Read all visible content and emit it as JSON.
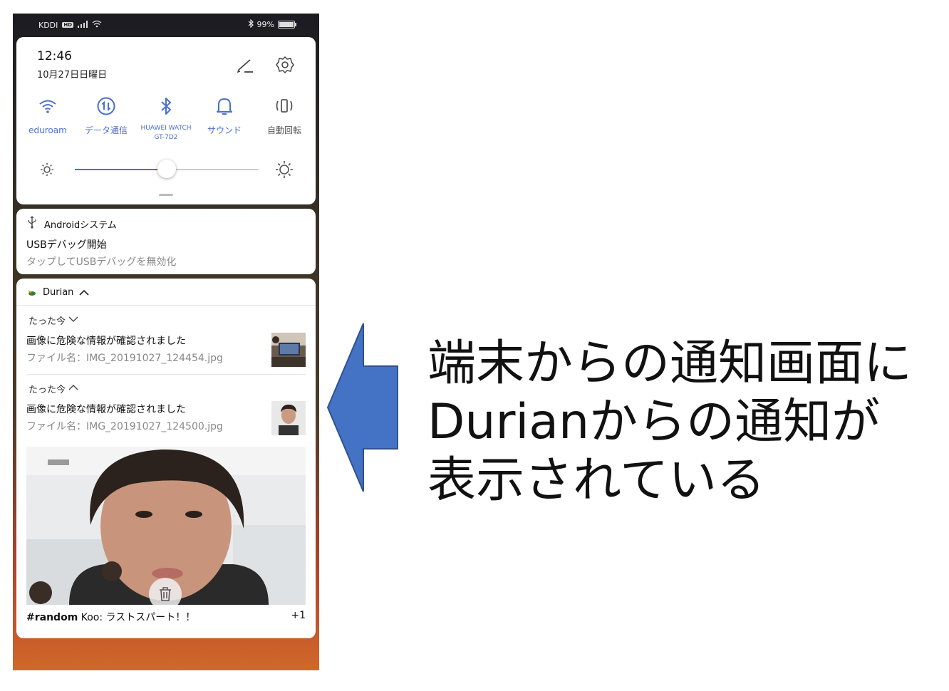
{
  "status_bar": {
    "carrier": "KDDI",
    "hd": "HD",
    "battery": "99%"
  },
  "quick_settings": {
    "time": "12:46",
    "date": "10月27日日曜日",
    "tiles": [
      {
        "label": "eduroam",
        "icon": "wifi-icon"
      },
      {
        "label": "データ通信",
        "icon": "data-icon"
      },
      {
        "label": "HUAWEI WATCH",
        "label2": "GT-7D2",
        "icon": "bluetooth-icon"
      },
      {
        "label": "サウンド",
        "icon": "bell-icon"
      },
      {
        "label": "自動回転",
        "icon": "rotate-icon"
      }
    ],
    "brightness_fraction": 0.5
  },
  "system_notification": {
    "app": "Androidシステム",
    "title": "USBデバッグ開始",
    "text": "タップしてUSBデバッグを無効化"
  },
  "durian_notification": {
    "app": "Durian",
    "items": [
      {
        "time": "たった今",
        "title": "画像に危険な情報が確認されました",
        "text": "ファイル名：IMG_20191027_124454.jpg"
      },
      {
        "time": "たった今",
        "title": "画像に危険な情報が確認されました",
        "text": "ファイル名：IMG_20191027_124500.jpg"
      }
    ]
  },
  "random_notification": {
    "channel": "#random",
    "message": "Koo: ラストスパート！！",
    "count": "+1"
  },
  "annotation": {
    "line1": "端末からの通知画面に",
    "line2": "Durianからの通知が",
    "line3": "表示されている"
  },
  "colors": {
    "accent": "#4a6fd1",
    "arrow": "#4472c4",
    "arrow_border": "#2f528f"
  }
}
